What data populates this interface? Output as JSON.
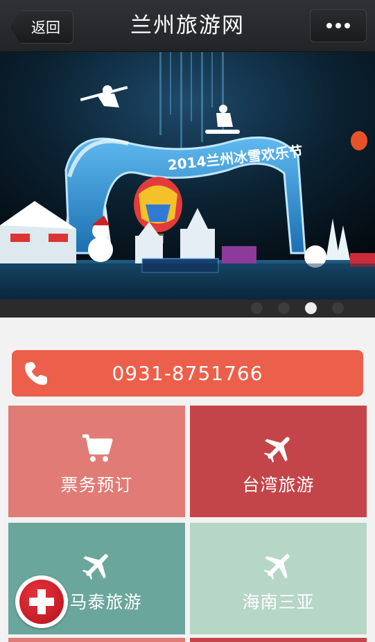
{
  "nav": {
    "back_label": "返回",
    "title": "兰州旅游网",
    "more_icon": "more-dots-icon"
  },
  "banner": {
    "sign_text": "2014兰州冰雪欢乐节",
    "slide_count": 4,
    "active_slide": 3
  },
  "contact": {
    "phone": "0931-8751766",
    "icon": "phone-icon"
  },
  "tiles": [
    {
      "label": "票务预订",
      "icon": "cart-icon",
      "color": "#e07b76"
    },
    {
      "label": "台湾旅游",
      "icon": "airplane-icon",
      "color": "#c44549"
    },
    {
      "label": "新马泰旅游",
      "icon": "airplane-icon",
      "color": "#6aa69c"
    },
    {
      "label": "海南三亚",
      "icon": "airplane-icon",
      "color": "#b6d6c6"
    }
  ],
  "fab": {
    "icon": "plus-icon",
    "color": "#d61f2a"
  }
}
